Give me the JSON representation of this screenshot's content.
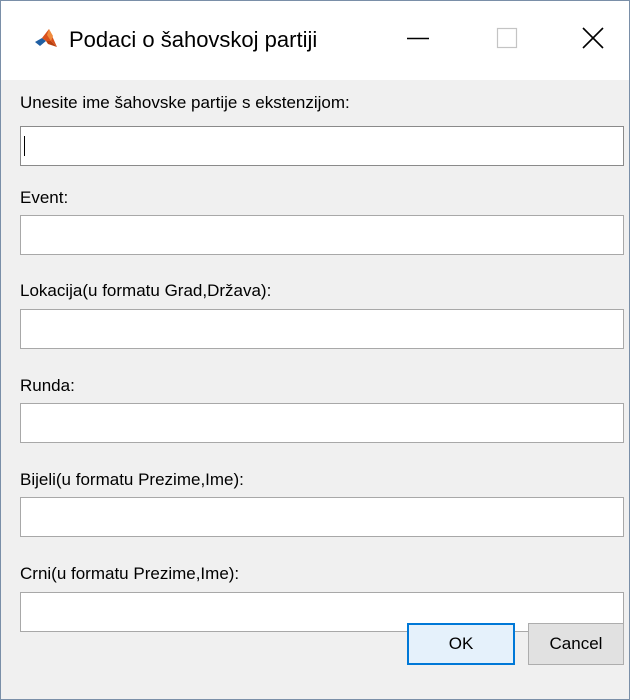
{
  "window": {
    "title": "Podaci o šahovskoj partiji",
    "app_icon": "matlab-icon",
    "controls": {
      "minimize": "minimize-icon",
      "maximize": "maximize-icon",
      "close": "close-icon"
    }
  },
  "fields": [
    {
      "label": "Unesite ime šahovske partije s ekstenzijom:",
      "value": "",
      "placeholder": ""
    },
    {
      "label": "Event:",
      "value": "",
      "placeholder": ""
    },
    {
      "label": "Lokacija(u formatu Grad,Država):",
      "value": "",
      "placeholder": ""
    },
    {
      "label": "Runda:",
      "value": "",
      "placeholder": ""
    },
    {
      "label": "Bijeli(u formatu Prezime,Ime):",
      "value": "",
      "placeholder": ""
    },
    {
      "label": "Crni(u formatu Prezime,Ime):",
      "value": "",
      "placeholder": ""
    }
  ],
  "buttons": {
    "ok_label": "OK",
    "cancel_label": "Cancel"
  },
  "colors": {
    "window_background": "#f0f0f0",
    "focus_accent": "#0078d7",
    "matlab_orange": "#d9501c",
    "matlab_blue": "#1f5fa3"
  }
}
